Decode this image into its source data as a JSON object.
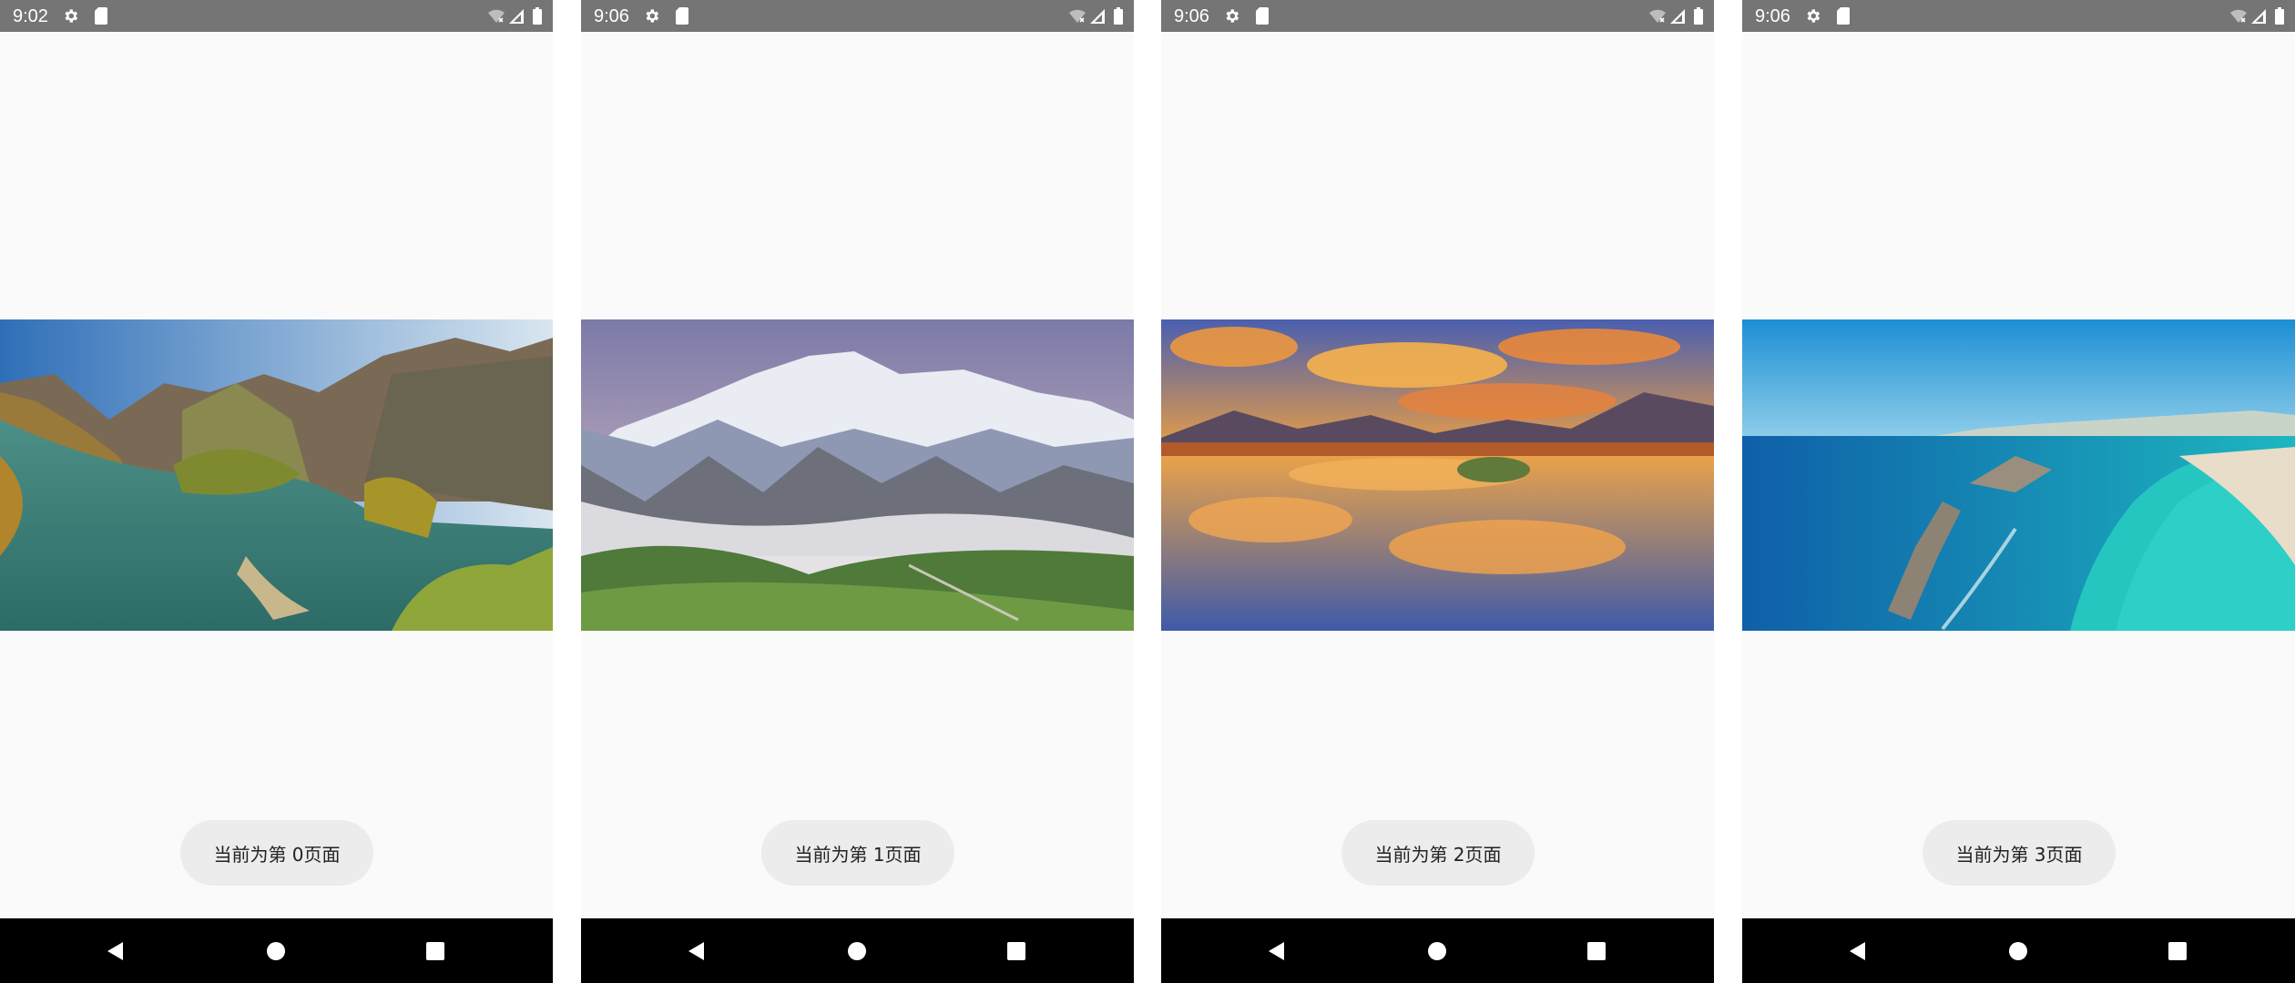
{
  "screens": [
    {
      "time": "9:02",
      "toast": "当前为第 0页面",
      "image": "autumn river valley landscape"
    },
    {
      "time": "9:06",
      "toast": "当前为第 1页面",
      "image": "snowy mountains above misty green hills"
    },
    {
      "time": "9:06",
      "toast": "当前为第 2页面",
      "image": "sunset clouds reflected on lake"
    },
    {
      "time": "9:06",
      "toast": "当前为第 3页面",
      "image": "turquoise ocean coastline with beach"
    }
  ],
  "status_icons": [
    "gear-icon",
    "sd-card-icon",
    "wifi-icon",
    "signal-icon",
    "battery-icon"
  ],
  "nav_icons": [
    "back-icon",
    "home-icon",
    "recents-icon"
  ],
  "colors": {
    "status_bar": "#757575",
    "background": "#fafafa",
    "toast": "#ececec",
    "nav_bar": "#000000"
  }
}
